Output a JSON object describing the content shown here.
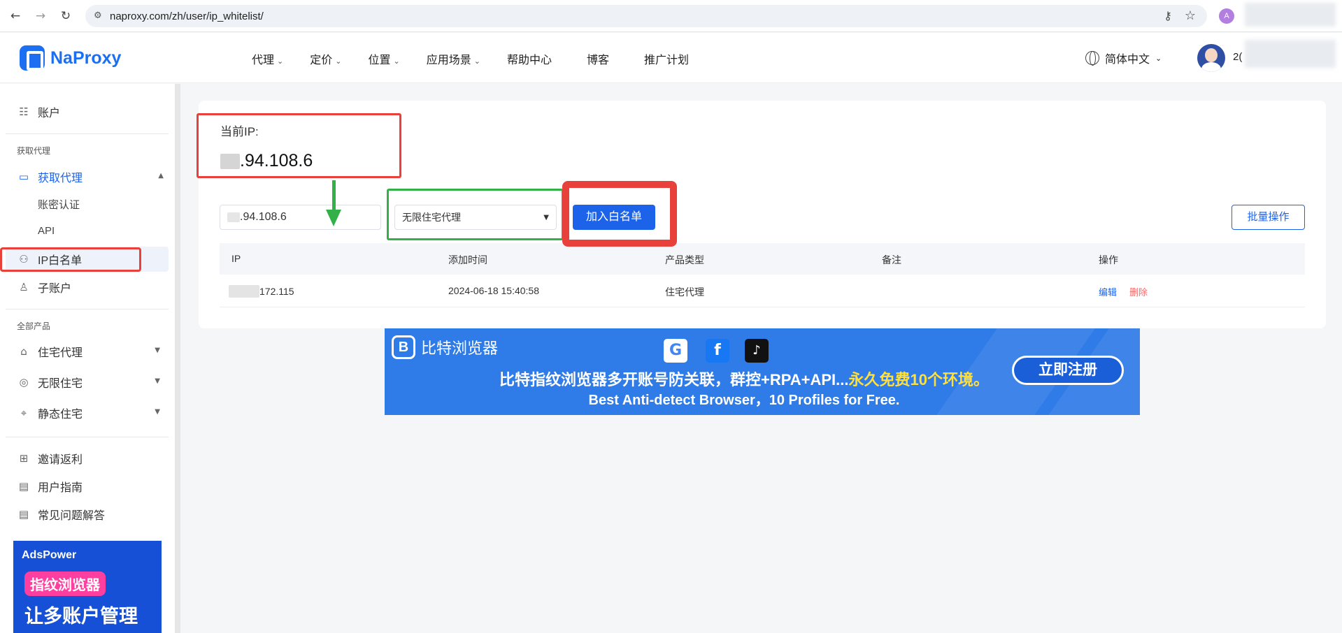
{
  "browser": {
    "back": "←",
    "forward": "→",
    "reload": "↻",
    "url": "naproxy.com/zh/user/ip_whitelist/",
    "profile_initial": "A"
  },
  "header": {
    "logo_text": "NaProxy",
    "nav": [
      {
        "label": "代理",
        "has_dropdown": true
      },
      {
        "label": "定价",
        "has_dropdown": true
      },
      {
        "label": "位置",
        "has_dropdown": true
      },
      {
        "label": "应用场景",
        "has_dropdown": true
      },
      {
        "label": "帮助中心",
        "has_dropdown": false
      },
      {
        "label": "博客",
        "has_dropdown": false
      },
      {
        "label": "推广计划",
        "has_dropdown": false
      }
    ],
    "language": "简体中文",
    "user_name": "2("
  },
  "sidebar": {
    "account": "账户",
    "group_get_proxy": "获取代理",
    "get_proxy": "获取代理",
    "sub_auth": "账密认证",
    "sub_api": "API",
    "ip_whitelist": "IP白名单",
    "sub_account": "子账户",
    "group_all_products": "全部产品",
    "residential": "住宅代理",
    "unlimited": "无限住宅",
    "static": "静态住宅",
    "invite": "邀请返利",
    "guide": "用户指南",
    "faq": "常见问题解答",
    "ad": {
      "brand": "AdsPower",
      "badge": "指纹浏览器",
      "headline": "让多账户管理"
    }
  },
  "whitelist": {
    "current_ip_label": "当前IP:",
    "current_ip_visible": ".94.108.6",
    "input_value": ".94.108.6",
    "product_select": "无限住宅代理",
    "add_button": "加入白名单",
    "batch_button": "批量操作",
    "columns": [
      "IP",
      "添加时间",
      "产品类型",
      "备注",
      "操作"
    ],
    "rows": [
      {
        "ip_visible": "172.115",
        "added": "2024-06-18 15:40:58",
        "product": "住宅代理",
        "note": "",
        "edit": "编辑",
        "delete": "删除"
      }
    ]
  },
  "banner": {
    "brand": "比特浏览器",
    "line1_main": "比特指纹浏览器多开账号防关联，群控+RPA+API...",
    "line1_highlight": "永久免费10个环境。",
    "line2": "Best Anti-detect Browser，10 Profiles for Free.",
    "cta": "立即注册"
  },
  "colors": {
    "primary": "#1d63ea",
    "danger_text": "#f56c6c",
    "annotation_red": "#e8413b",
    "annotation_green": "#34b049"
  }
}
